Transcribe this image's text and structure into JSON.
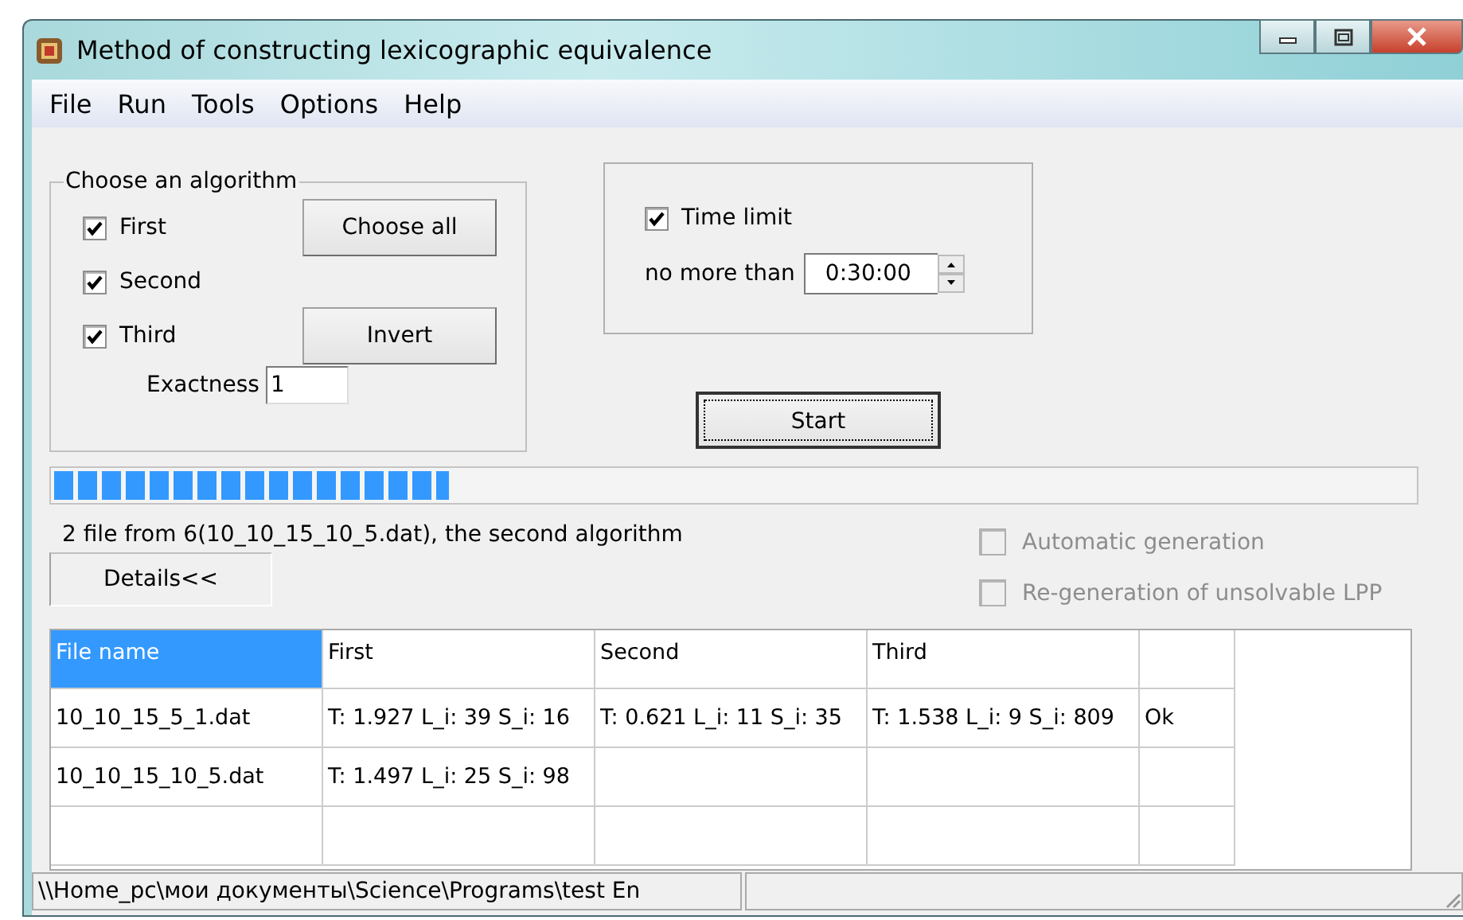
{
  "window": {
    "title": "Method of constructing lexicographic equivalence"
  },
  "menu": [
    "File",
    "Run",
    "Tools",
    "Options",
    "Help"
  ],
  "algorithm_group": {
    "title": "Choose an algorithm",
    "algorithms": [
      {
        "label": "First",
        "checked": true
      },
      {
        "label": "Second",
        "checked": true
      },
      {
        "label": "Third",
        "checked": true
      }
    ],
    "buttons": [
      "Choose all",
      "Invert"
    ],
    "exactness": {
      "label": "Exactness",
      "value": "1"
    }
  },
  "time_group": {
    "time_limit": {
      "label": "Time limit",
      "checked": true
    },
    "limit_label": "no more than",
    "limit_value": "0:30:00"
  },
  "start_button": "Start",
  "progress": {
    "level": 0.29
  },
  "status_text": "2 file from 6(10_10_15_10_5.dat), the second algorithm",
  "details_button": "Details<<",
  "options": [
    {
      "label": "Automatic generation",
      "checked": false,
      "disabled": true
    },
    {
      "label": "Re-generation of unsolvable LPP",
      "checked": false,
      "disabled": true
    }
  ],
  "table": {
    "columns": [
      {
        "label": "File name",
        "selected": true
      },
      {
        "label": "First",
        "selected": false
      },
      {
        "label": "Second",
        "selected": false
      },
      {
        "label": "Third",
        "selected": false
      },
      {
        "selected": false
      }
    ],
    "rows": [
      {
        "cells": [
          "10_10_15_5_1.dat",
          "T: 1.927 L_i: 39 S_i: 16",
          "T: 0.621 L_i: 11 S_i: 35",
          "T: 1.538 L_i: 9 S_i: 809",
          "Ok"
        ]
      },
      {
        "cells": [
          "10_10_15_10_5.dat",
          "T: 1.497 L_i: 25 S_i: 98"
        ]
      }
    ]
  },
  "status_bar": {
    "path": "\\\\Home_pc\\мои документы\\Science\\Programs\\test En"
  }
}
